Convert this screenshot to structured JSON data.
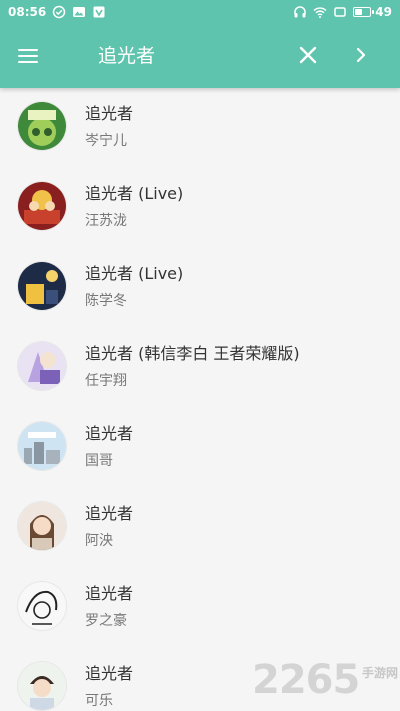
{
  "status_bar": {
    "time": "08:56",
    "battery_percent": "49"
  },
  "toolbar": {
    "search_query": "追光者",
    "menu_icon": "hamburger-menu-icon",
    "clear_icon": "close-icon",
    "next_icon": "chevron-right-icon"
  },
  "colors": {
    "accent": "#5fc4ad",
    "background": "#f5f5f5",
    "title_text": "#333333",
    "artist_text": "#777777"
  },
  "songs": [
    {
      "title": "追光者",
      "artist": "岑宁儿"
    },
    {
      "title": "追光者 (Live)",
      "artist": "汪苏泷"
    },
    {
      "title": "追光者 (Live)",
      "artist": "陈学冬"
    },
    {
      "title": "追光者 (韩信李白 王者荣耀版)",
      "artist": "任宇翔"
    },
    {
      "title": "追光者",
      "artist": "国哥"
    },
    {
      "title": "追光者",
      "artist": "阿泱"
    },
    {
      "title": "追光者",
      "artist": "罗之豪"
    },
    {
      "title": "追光者",
      "artist": "可乐"
    }
  ],
  "watermark": {
    "number": "2265",
    "text": "手游网"
  }
}
